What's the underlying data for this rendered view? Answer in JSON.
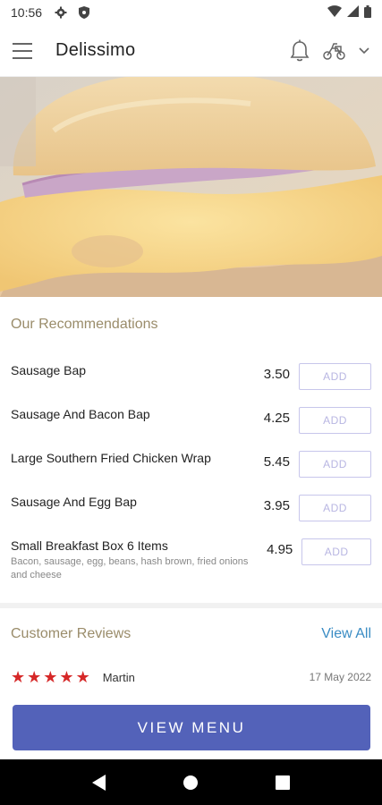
{
  "status_bar": {
    "time": "10:56",
    "icons": [
      "settings-icon",
      "shield-icon",
      "wifi-icon",
      "signal-icon",
      "battery-icon"
    ]
  },
  "app_bar": {
    "title": "Delissimo",
    "icons": [
      "menu-icon",
      "bell-icon",
      "delivery-icon",
      "chevron-down-icon"
    ]
  },
  "hero": {
    "image": "burger-photo"
  },
  "recommendations": {
    "title": "Our Recommendations",
    "add_label": "ADD",
    "items": [
      {
        "name": "Sausage Bap",
        "price": "3.50",
        "desc": ""
      },
      {
        "name": "Sausage And Bacon Bap",
        "price": "4.25",
        "desc": ""
      },
      {
        "name": "Large Southern Fried Chicken Wrap",
        "price": "5.45",
        "desc": ""
      },
      {
        "name": "Sausage And Egg Bap",
        "price": "3.95",
        "desc": ""
      },
      {
        "name": "Small Breakfast Box 6 Items",
        "price": "4.95",
        "desc": "Bacon, sausage, egg, beans, hash brown, fried onions and cheese"
      }
    ]
  },
  "reviews": {
    "title": "Customer Reviews",
    "view_all": "View All",
    "latest": {
      "stars": 5,
      "reviewer": "Martin",
      "date": "17 May 2022"
    }
  },
  "cta": {
    "label": "VIEW MENU"
  },
  "nav_bar": {
    "icons": [
      "back-icon",
      "home-icon",
      "recents-icon"
    ]
  },
  "colors": {
    "accent": "#5362b9",
    "section_title": "#9a8c6a",
    "link": "#3a8cc4",
    "star": "#d62828",
    "add_border": "#c7c6eb"
  }
}
